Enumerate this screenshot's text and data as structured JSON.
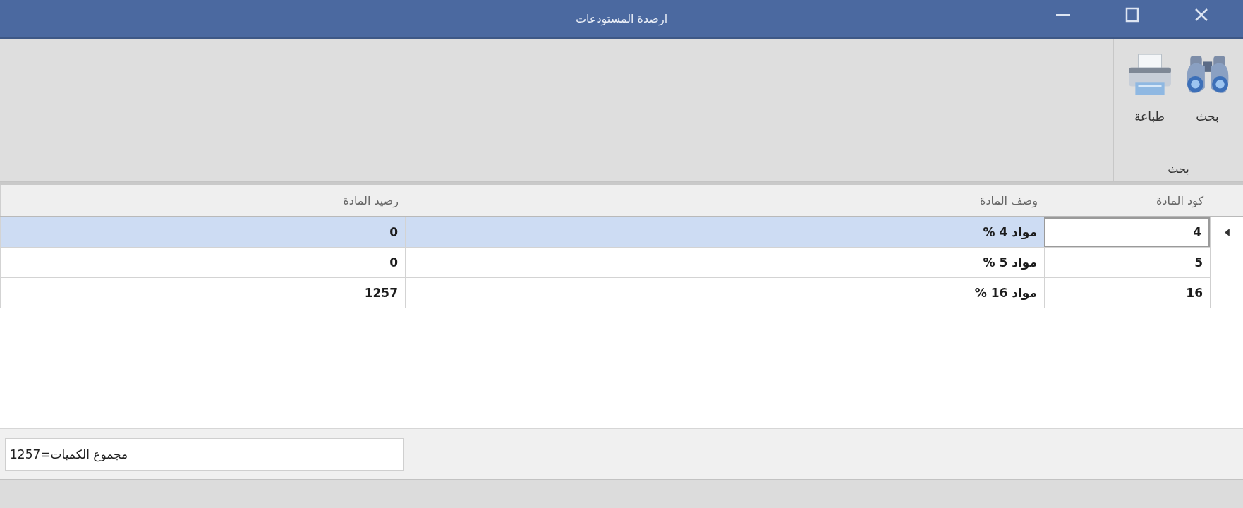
{
  "window": {
    "title": "ارصدة المستودعات"
  },
  "ribbon": {
    "groups": [
      {
        "label": "بحث",
        "buttons": [
          {
            "label": "بحث",
            "kind": "search"
          },
          {
            "label": "طباعة",
            "kind": "print"
          }
        ]
      }
    ]
  },
  "table": {
    "columns": [
      "كود المادة",
      "وصف المادة",
      "رصيد المادة"
    ],
    "rows": [
      {
        "cells": [
          "4",
          "مواد 4 %",
          "0"
        ],
        "selected": true
      },
      {
        "cells": [
          "5",
          "مواد 5 %",
          "0"
        ],
        "selected": false
      },
      {
        "cells": [
          "16",
          "مواد 16 %",
          "1257"
        ],
        "selected": false
      }
    ]
  },
  "footer": {
    "total_field": {
      "value": "مجموع الكميات=1257"
    }
  }
}
